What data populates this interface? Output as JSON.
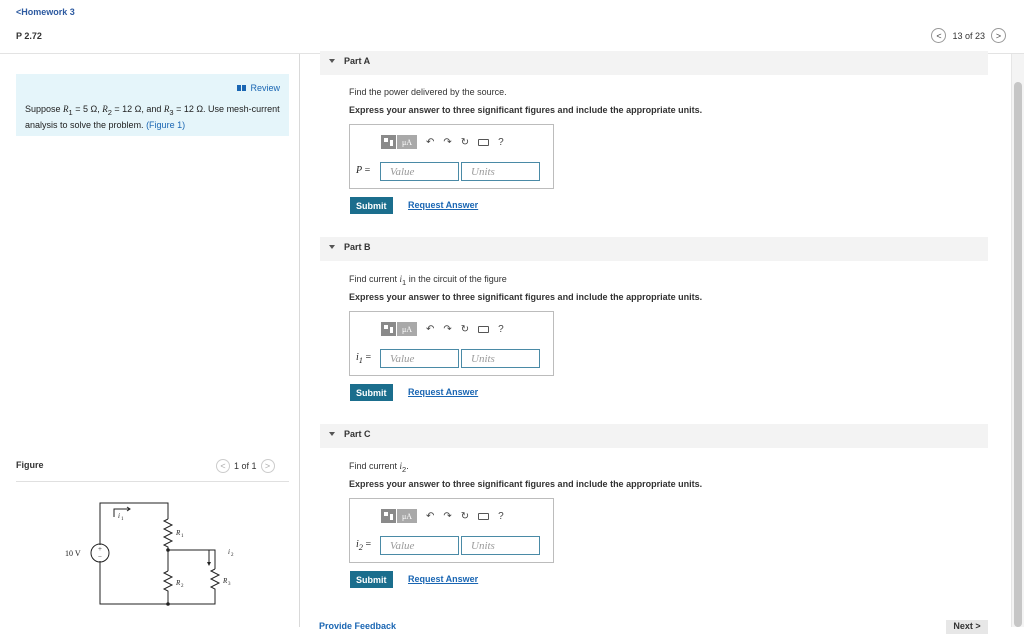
{
  "header": {
    "back_label": "<Homework 3",
    "problem_title": "P 2.72",
    "pager_text": "13 of 23",
    "prev_glyph": "<",
    "next_glyph": ">"
  },
  "review": {
    "link_label": "Review",
    "text_1": "Suppose ",
    "r1": "R",
    "r1_sub": "1",
    "text_2": " = 5 Ω, ",
    "r2": "R",
    "r2_sub": "2",
    "text_3": " = 12 Ω, and ",
    "r3": "R",
    "r3_sub": "3",
    "text_4": " = 12 Ω. Use mesh-current analysis to solve the problem. ",
    "figure_link": "(Figure 1)"
  },
  "figure": {
    "label": "Figure",
    "pager_text": "1 of 1",
    "prev_glyph": "<",
    "next_glyph": ">",
    "source_label": "10 V",
    "i1": "i",
    "i1_sub": "1",
    "i2": "i",
    "i2_sub": "2",
    "r1": "R",
    "r1_sub": "1",
    "r2": "R",
    "r2_sub": "2",
    "r3": "R",
    "r3_sub": "3",
    "plus": "+",
    "minus": "−"
  },
  "toolbar": {
    "mu_label": "μA",
    "undo": "↶",
    "redo": "↷",
    "reset": "↻",
    "help": "?"
  },
  "parts": {
    "a": {
      "label": "Part A",
      "question": "Find the power delivered by the source.",
      "instruction": "Express your answer to three significant figures and include the appropriate units.",
      "var": "P",
      "var_sub": "",
      "eq": " =",
      "value_placeholder": "Value",
      "units_placeholder": "Units",
      "submit": "Submit",
      "request": "Request Answer"
    },
    "b": {
      "label": "Part B",
      "question_1": "Find current ",
      "q_var": "i",
      "q_sub": "1",
      "question_2": " in the circuit of the figure",
      "instruction": "Express your answer to three significant figures and include the appropriate units.",
      "var": "i",
      "var_sub": "1",
      "eq": " =",
      "value_placeholder": "Value",
      "units_placeholder": "Units",
      "submit": "Submit",
      "request": "Request Answer"
    },
    "c": {
      "label": "Part C",
      "question_1": "Find current ",
      "q_var": "i",
      "q_sub": "2",
      "question_2": ".",
      "instruction": "Express your answer to three significant figures and include the appropriate units.",
      "var": "i",
      "var_sub": "2",
      "eq": " =",
      "value_placeholder": "Value",
      "units_placeholder": "Units",
      "submit": "Submit",
      "request": "Request Answer"
    }
  },
  "footer": {
    "feedback": "Provide Feedback",
    "next": "Next >"
  }
}
